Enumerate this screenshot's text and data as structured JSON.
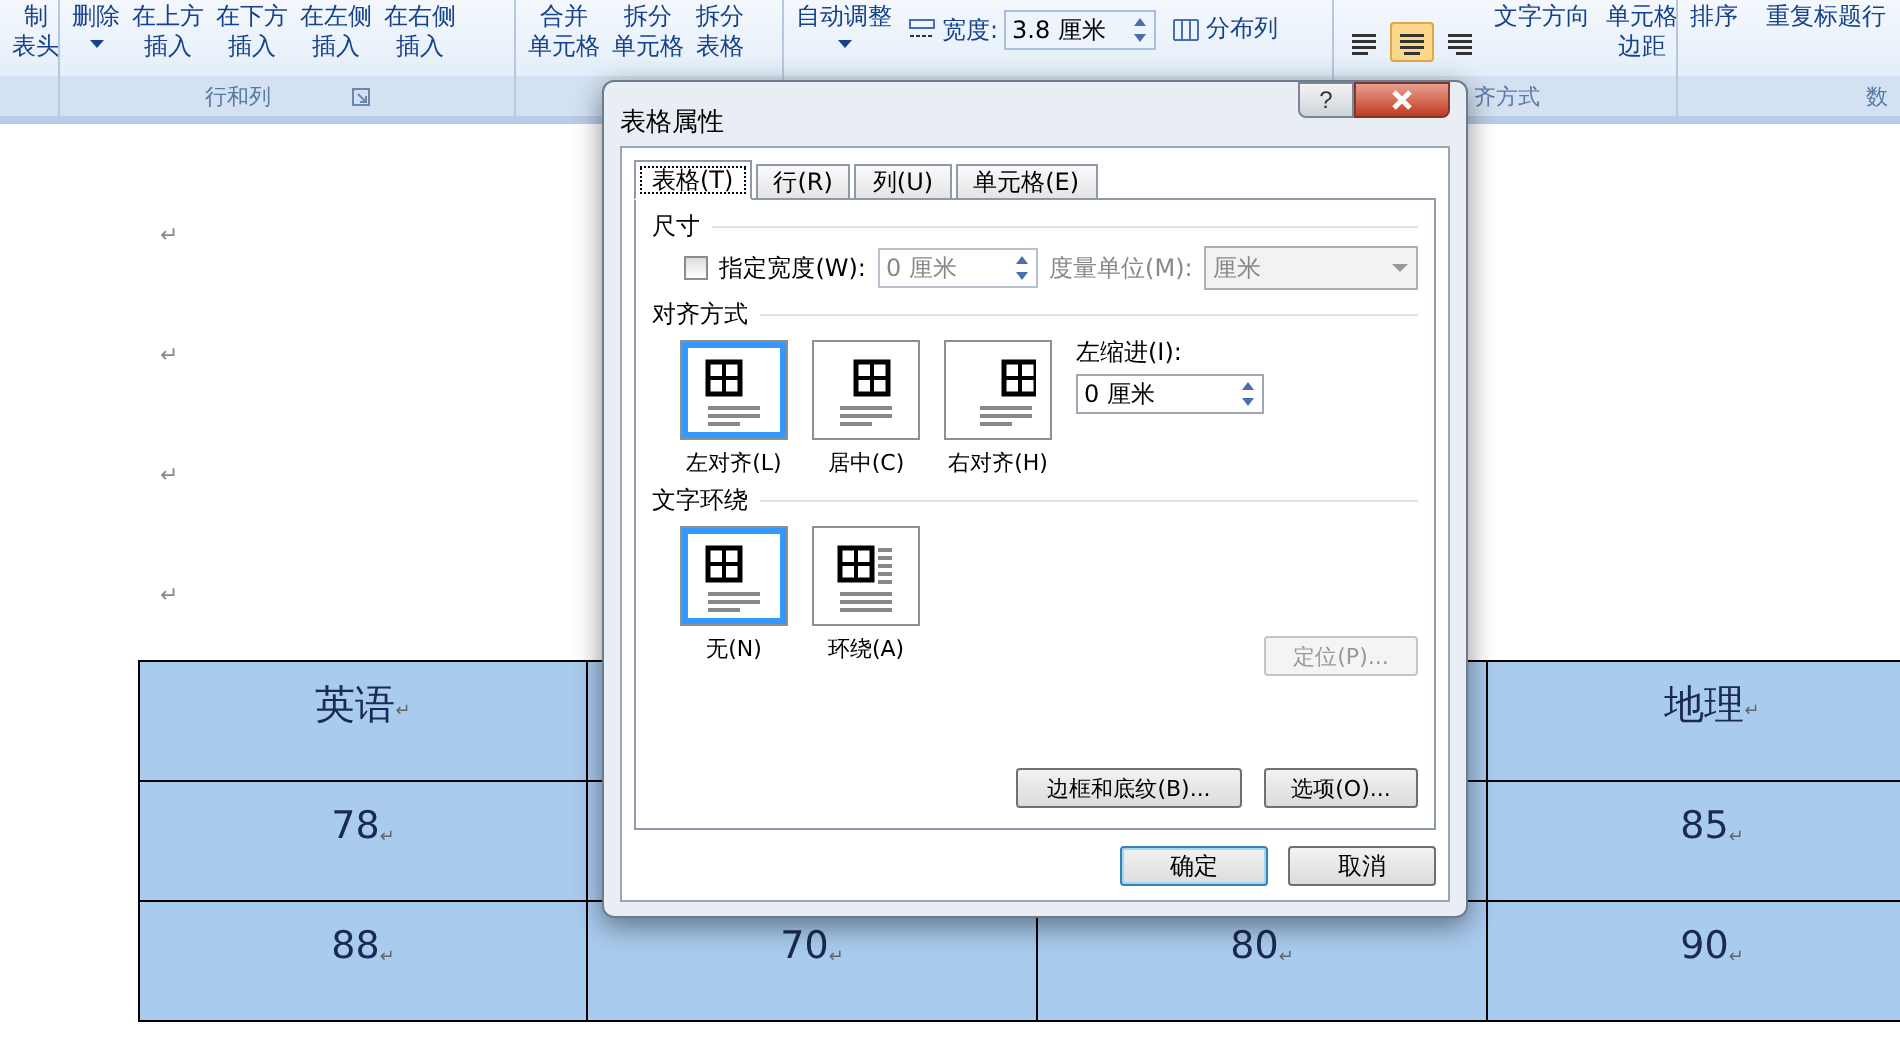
{
  "ribbon": {
    "groups": [
      {
        "buttons": [
          {
            "lines": [
              "制",
              "表头"
            ],
            "dropdown": false
          }
        ]
      },
      {
        "label": "行和列",
        "launcher": true,
        "buttons": [
          {
            "lines": [
              "删除"
            ],
            "dropdown": true
          },
          {
            "lines": [
              "在上方",
              "插入"
            ],
            "dropdown": false
          },
          {
            "lines": [
              "在下方",
              "插入"
            ],
            "dropdown": false
          },
          {
            "lines": [
              "在左侧",
              "插入"
            ],
            "dropdown": false
          },
          {
            "lines": [
              "在右侧",
              "插入"
            ],
            "dropdown": false
          }
        ]
      },
      {
        "buttons": [
          {
            "lines": [
              "合并",
              "单元格"
            ],
            "dropdown": false
          },
          {
            "lines": [
              "拆分",
              "单元格"
            ],
            "dropdown": false
          },
          {
            "lines": [
              "拆分",
              "表格"
            ],
            "dropdown": false
          }
        ]
      }
    ],
    "autofit": {
      "label": "自动调整"
    },
    "width_field": {
      "label": "宽度:",
      "value": "3.8 厘米"
    },
    "distribute": {
      "label": "分布列"
    },
    "align_buttons": [
      {
        "kind": "left",
        "selected": false
      },
      {
        "kind": "center",
        "selected": true
      },
      {
        "kind": "right",
        "selected": false
      }
    ],
    "text_direction": {
      "label": "文字方向"
    },
    "cell_margins": {
      "lines": [
        "单元格",
        "边距"
      ]
    },
    "align_group_label": "齐方式",
    "sort": {
      "label": "排序"
    },
    "repeat_header": {
      "label": "重复标题行"
    },
    "data_group_label": "数"
  },
  "document": {
    "paragraph_marks": [
      "↵",
      "↵",
      "↵",
      "↵"
    ],
    "table": {
      "rows": [
        [
          {
            "text": "英语",
            "mark": "↵"
          },
          null,
          null,
          {
            "text": "地理",
            "mark": "↵"
          }
        ],
        [
          {
            "text": "78",
            "mark": "↵"
          },
          null,
          null,
          {
            "text": "85",
            "mark": "↵"
          }
        ],
        [
          {
            "text": "88",
            "mark": "↵"
          },
          {
            "text": "70",
            "mark": "↵"
          },
          {
            "text": "80",
            "mark": "↵"
          },
          {
            "text": "90",
            "mark": "↵"
          }
        ]
      ]
    }
  },
  "dialog": {
    "title": "表格属性",
    "help": "?",
    "tabs": [
      {
        "label": "表格(T)",
        "selected": true
      },
      {
        "label": "行(R)",
        "selected": false
      },
      {
        "label": "列(U)",
        "selected": false
      },
      {
        "label": "单元格(E)",
        "selected": false
      }
    ],
    "size_section": {
      "title": "尺寸",
      "checkbox": {
        "label": "指定宽度(W):",
        "checked": false
      },
      "width": {
        "value": "0 厘米",
        "disabled": true
      },
      "unit_label": {
        "text": "度量单位(M):",
        "disabled": true
      },
      "unit": {
        "value": "厘米",
        "disabled": true
      }
    },
    "align_section": {
      "title": "对齐方式",
      "options": [
        {
          "kind": "left",
          "label": "左对齐(L)",
          "selected": true
        },
        {
          "kind": "center",
          "label": "居中(C)",
          "selected": false
        },
        {
          "kind": "right",
          "label": "右对齐(H)",
          "selected": false
        }
      ],
      "indent_label": "左缩进(I):",
      "indent_value": "0 厘米"
    },
    "wrap_section": {
      "title": "文字环绕",
      "options": [
        {
          "kind": "none",
          "label": "无(N)",
          "selected": true
        },
        {
          "kind": "around",
          "label": "环绕(A)",
          "selected": false
        }
      ],
      "position_button": {
        "label": "定位(P)...",
        "disabled": true
      }
    },
    "borders_button": "边框和底纹(B)...",
    "options_button": "选项(O)...",
    "ok": "确定",
    "cancel": "取消"
  }
}
